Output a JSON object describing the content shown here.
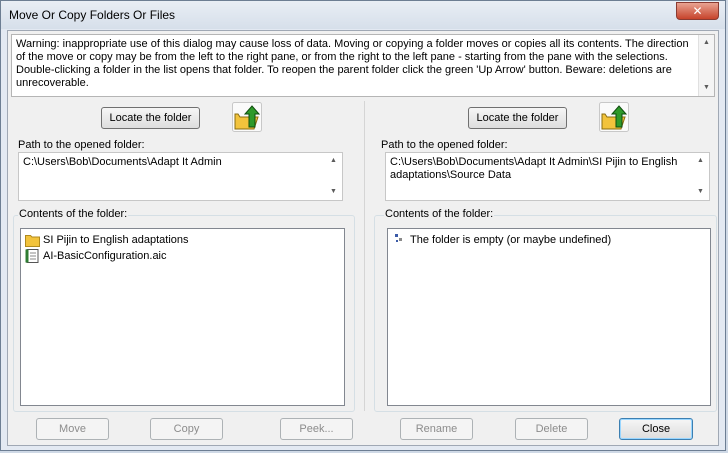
{
  "window": {
    "title": "Move Or Copy Folders Or Files",
    "close_glyph": "✕"
  },
  "warning": {
    "text": "Warning: inappropriate use of this dialog may cause loss of data. Moving or copying a folder moves or copies all its contents. The direction of the move or copy may be from the left to the right pane, or from the right to the left pane - starting from the pane with the selections. Double-clicking a folder in the list opens that folder. To reopen the parent folder click the green 'Up Arrow' button. Beware: deletions are unrecoverable."
  },
  "left": {
    "locate_label": "Locate the folder",
    "path_label": "Path to the opened folder:",
    "path_value": "C:\\Users\\Bob\\Documents\\Adapt It Admin",
    "contents_label": "Contents of the folder:",
    "items": [
      {
        "name": "SI Pijin to English adaptations",
        "icon": "folder-icon"
      },
      {
        "name": "AI-BasicConfiguration.aic",
        "icon": "config-file-icon"
      }
    ]
  },
  "right": {
    "locate_label": "Locate the folder",
    "path_label": "Path to the opened folder:",
    "path_value": "C:\\Users\\Bob\\Documents\\Adapt It Admin\\SI Pijin to English adaptations\\Source Data",
    "contents_label": "Contents of the folder:",
    "items": [
      {
        "name": "The folder is empty (or maybe undefined)",
        "icon": "empty-indicator-icon"
      }
    ]
  },
  "buttons": {
    "move": "Move",
    "copy": "Copy",
    "peek": "Peek...",
    "rename": "Rename",
    "delete": "Delete",
    "close": "Close"
  },
  "colors": {
    "folder": "#f2c33c",
    "up_arrow": "#2e9a2a",
    "window_frame": "#cfd9e6",
    "close_button": "#c7432b"
  }
}
